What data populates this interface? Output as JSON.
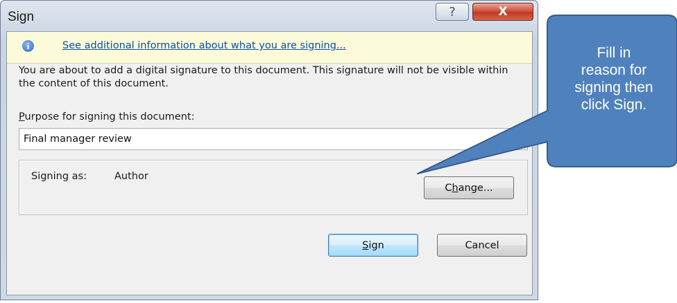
{
  "window": {
    "title": "Sign",
    "help_glyph": "?",
    "close_glyph": "X"
  },
  "infobar": {
    "icon": "info-icon",
    "icon_glyph": "i",
    "link_text": "See additional information about what you are signing..."
  },
  "description": "You are about to add a digital signature to this document. This signature will not be visible within the content of this document.",
  "purpose": {
    "label_accel": "P",
    "label_rest": "urpose for signing this document:",
    "value": "Final manager review"
  },
  "signing_as": {
    "label": "Signing as:",
    "value": "Author"
  },
  "buttons": {
    "change_pre": "C",
    "change_accel": "h",
    "change_post": "ange...",
    "sign_accel": "S",
    "sign_rest": "ign",
    "cancel": "Cancel"
  },
  "callout": {
    "line1": "Fill in",
    "line2": "reason for",
    "line3": "signing then",
    "line4": "click Sign."
  },
  "colors": {
    "callout_fill": "#4f81bd",
    "callout_border": "#385d8a",
    "link": "#0b4ea6",
    "infobar_bg": "#fbfbd9"
  }
}
